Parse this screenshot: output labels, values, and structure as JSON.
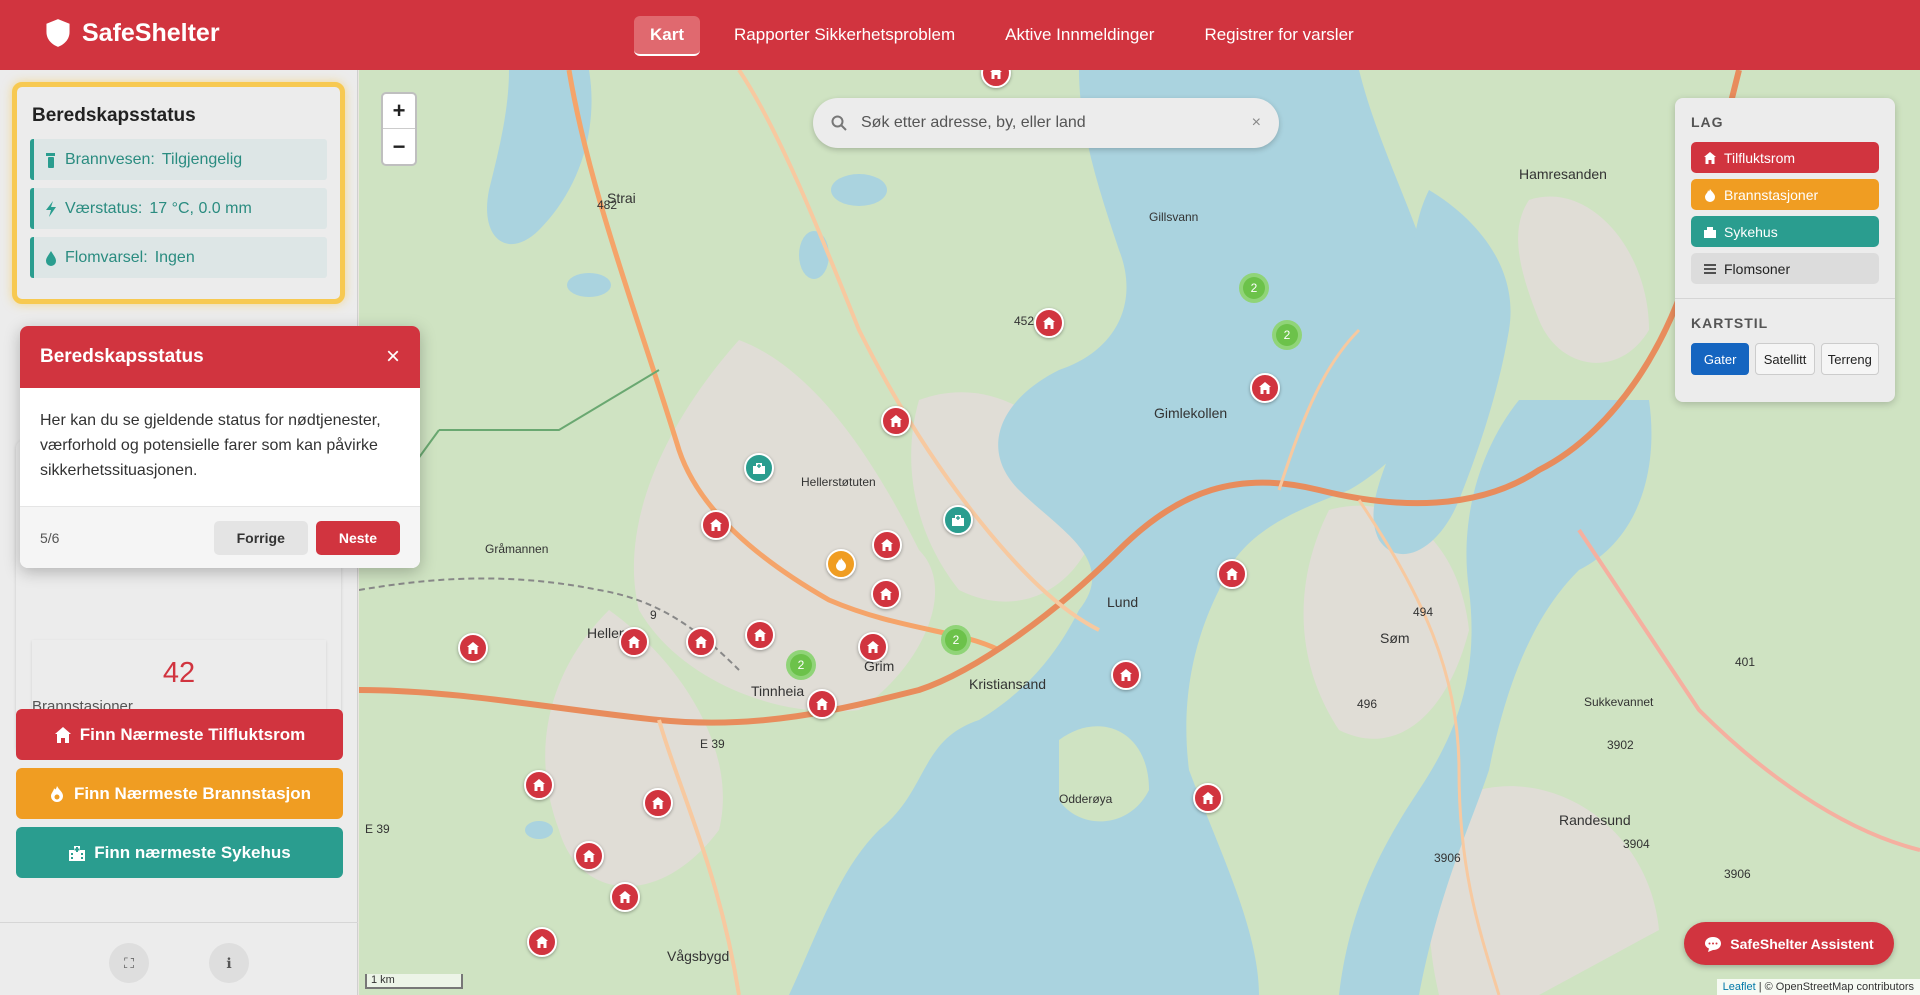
{
  "app": {
    "name": "SafeShelter"
  },
  "nav": {
    "items": [
      "Kart",
      "Rapporter Sikkerhetsproblem",
      "Aktive Innmeldinger",
      "Registrer for varsler"
    ],
    "active": "Kart"
  },
  "status_panel": {
    "title": "Beredskapsstatus",
    "rows": [
      {
        "label": "Brannvesen:",
        "value": "Tilgjengelig",
        "icon": "fire-extinguisher-icon"
      },
      {
        "label": "Værstatus:",
        "value": "17 °C, 0.0 mm",
        "icon": "bolt-icon"
      },
      {
        "label": "Flomvarsel:",
        "value": "Ingen",
        "icon": "droplet-icon"
      }
    ]
  },
  "stats": {
    "fire_stations_count": "42",
    "fire_stations_label": "Brannstasjoner"
  },
  "actions": {
    "shelter": "Finn Nærmeste Tilfluktsrom",
    "fire": "Finn Nærmeste Brannstasjon",
    "hospital": "Finn nærmeste Sykehus"
  },
  "tour": {
    "title": "Beredskapsstatus",
    "close": "×",
    "text": "Her kan du se gjeldende status for nødtjenester, værforhold og potensielle farer som kan påvirke sikkerhetssituasjonen.",
    "step": "5/6",
    "prev": "Forrige",
    "next": "Neste"
  },
  "map": {
    "zoom_in": "+",
    "zoom_out": "−",
    "search_placeholder": "Søk etter adresse, by, eller land",
    "clear": "×",
    "layers_title": "LAG",
    "layers": [
      "Tilfluktsrom",
      "Brannstasjoner",
      "Sykehus",
      "Flomsoner"
    ],
    "style_title": "KARTSTIL",
    "styles": [
      "Gater",
      "Satellitt",
      "Terreng"
    ],
    "active_style": "Gater",
    "assistant": "SafeShelter Assistent",
    "scale": "1 km",
    "attribution_leaflet": "Leaflet",
    "attribution_rest": "| © OpenStreetMap contributors",
    "cluster_labels": [
      "2",
      "2",
      "2",
      "2"
    ],
    "places": [
      "Strai",
      "Hellemyr",
      "Tinnheia",
      "Grim",
      "Kristiansand",
      "Lund",
      "Gimlekollen",
      "Søm",
      "Vågsbygd",
      "Hamresanden",
      "Randesund",
      "Odderøya",
      "Hellerstøtuten",
      "Gråmannen",
      "Sukkevannet",
      "Gillsvann"
    ],
    "road_labels": [
      "E 39",
      "E 39",
      "482",
      "452",
      "494",
      "496",
      "401",
      "3902",
      "3904",
      "3906",
      "3906",
      "9"
    ]
  },
  "colors": {
    "brand_red": "#d1343f",
    "orange": "#f09d22",
    "teal": "#2a9d8f",
    "blue": "#1565c0",
    "cluster_green": "#6cc24a",
    "warning_yellow": "#f7c951"
  }
}
